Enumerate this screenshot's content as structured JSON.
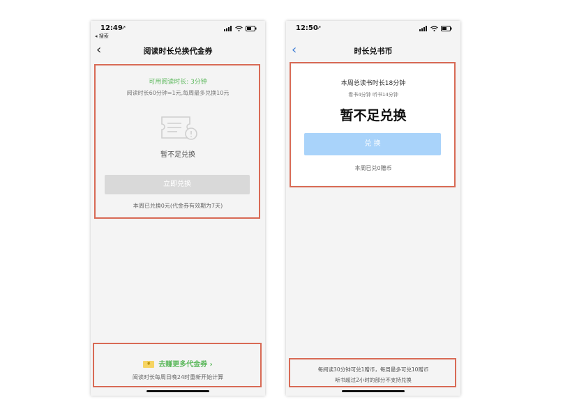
{
  "left": {
    "status": {
      "time": "12:49",
      "back_app": "◂ 搜索"
    },
    "nav": {
      "title": "阅读时长兑换代金券"
    },
    "card": {
      "available": "可用阅读时长: 3分钟",
      "rule": "阅读时长60分钟=1元,每周最多兑换10元",
      "empty_text": "暂不足兑换",
      "button": "立即兑换",
      "footnote": "本周已兑换0元(代金券有效期为7天)"
    },
    "bottom": {
      "earn_link": "去赚更多代金券 ›",
      "coupon_symbol": "¥",
      "reset_note": "阅读时长每周日晚24时重新开始计算"
    }
  },
  "right": {
    "status": {
      "time": "12:50"
    },
    "nav": {
      "title": "时长兑书币"
    },
    "card": {
      "total": "本周总读书时长18分钟",
      "detail": "看书4分钟 听书14分钟",
      "headline": "暂不足兑换",
      "button": "兑 换",
      "footnote": "本周已兑0赠币"
    },
    "bottom": {
      "line1": "每阅读30分钟可兑1赠币，每周最多可兑10赠币",
      "line2": "听书超过2小时的部分不支持兑换"
    }
  },
  "colors": {
    "highlight": "#d86a55",
    "green": "#5cb85c",
    "blue_button": "#a9d3fa"
  },
  "icons": [
    "location-arrow-icon",
    "signal-icon",
    "wifi-icon",
    "battery-icon",
    "back-chevron-icon",
    "ticket-icon",
    "coupon-mini-icon"
  ]
}
